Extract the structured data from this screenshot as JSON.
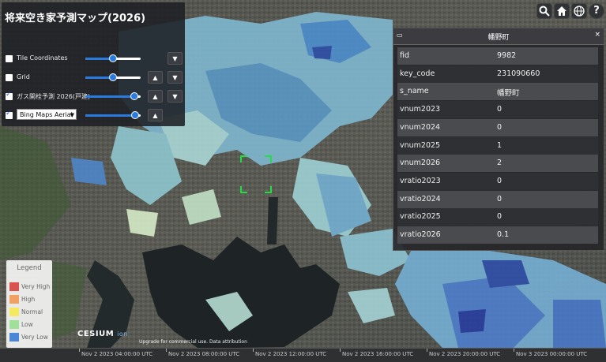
{
  "map_title": "将来空き家予測マップ(2026)",
  "layers": [
    {
      "label": "Tile Coordinates",
      "checked": false,
      "opacity": 0.5
    },
    {
      "label": "Grid",
      "checked": false,
      "opacity": 0.5
    },
    {
      "label": "ガス開栓予測 2026(戸建)",
      "checked": true,
      "opacity": 0.85
    },
    {
      "label": "Bing Maps Aerial",
      "checked": true,
      "opacity": 0.9
    }
  ],
  "buttons": {
    "up": "▲",
    "down": "▼"
  },
  "toolbar": {
    "search": "🔍",
    "home": "⌂",
    "globe": "🌐",
    "help": "?"
  },
  "info_box": {
    "title": "幡野町",
    "close": "×",
    "rows": [
      {
        "key": "fid",
        "value": "9982"
      },
      {
        "key": "key_code",
        "value": "231090660"
      },
      {
        "key": "s_name",
        "value": "幡野町"
      },
      {
        "key": "vnum2023",
        "value": "0"
      },
      {
        "key": "vnum2024",
        "value": "0"
      },
      {
        "key": "vnum2025",
        "value": "1"
      },
      {
        "key": "vnum2026",
        "value": "2"
      },
      {
        "key": "vratio2023",
        "value": "0"
      },
      {
        "key": "vratio2024",
        "value": "0"
      },
      {
        "key": "vratio2025",
        "value": "0"
      },
      {
        "key": "vratio2026",
        "value": "0.1"
      }
    ]
  },
  "legend": {
    "title": "Legend",
    "items": [
      {
        "label": "Very High",
        "color": "#d9534f"
      },
      {
        "label": "High",
        "color": "#f0a060"
      },
      {
        "label": "Normal",
        "color": "#f5e960"
      },
      {
        "label": "Low",
        "color": "#9fe09a"
      },
      {
        "label": "Very Low",
        "color": "#4a86d8"
      }
    ]
  },
  "cesium": {
    "logo": "CESIUM",
    "ion": "ion",
    "credits": "Upgrade for commercial use.   Data attribution"
  },
  "timeline": {
    "labels": [
      "Nov 2 2023 04:00:00 UTC",
      "Nov 2 2023 08:00:00 UTC",
      "Nov 2 2023 12:00:00 UTC",
      "Nov 2 2023 16:00:00 UTC",
      "Nov 2 2023 20:00:00 UTC",
      "Nov 3 2023 00:00:00 UTC"
    ]
  },
  "colors": {
    "panel_bg": "#1e2024",
    "slider_blue": "#2a7be0",
    "selection_green": "#22dd44"
  }
}
